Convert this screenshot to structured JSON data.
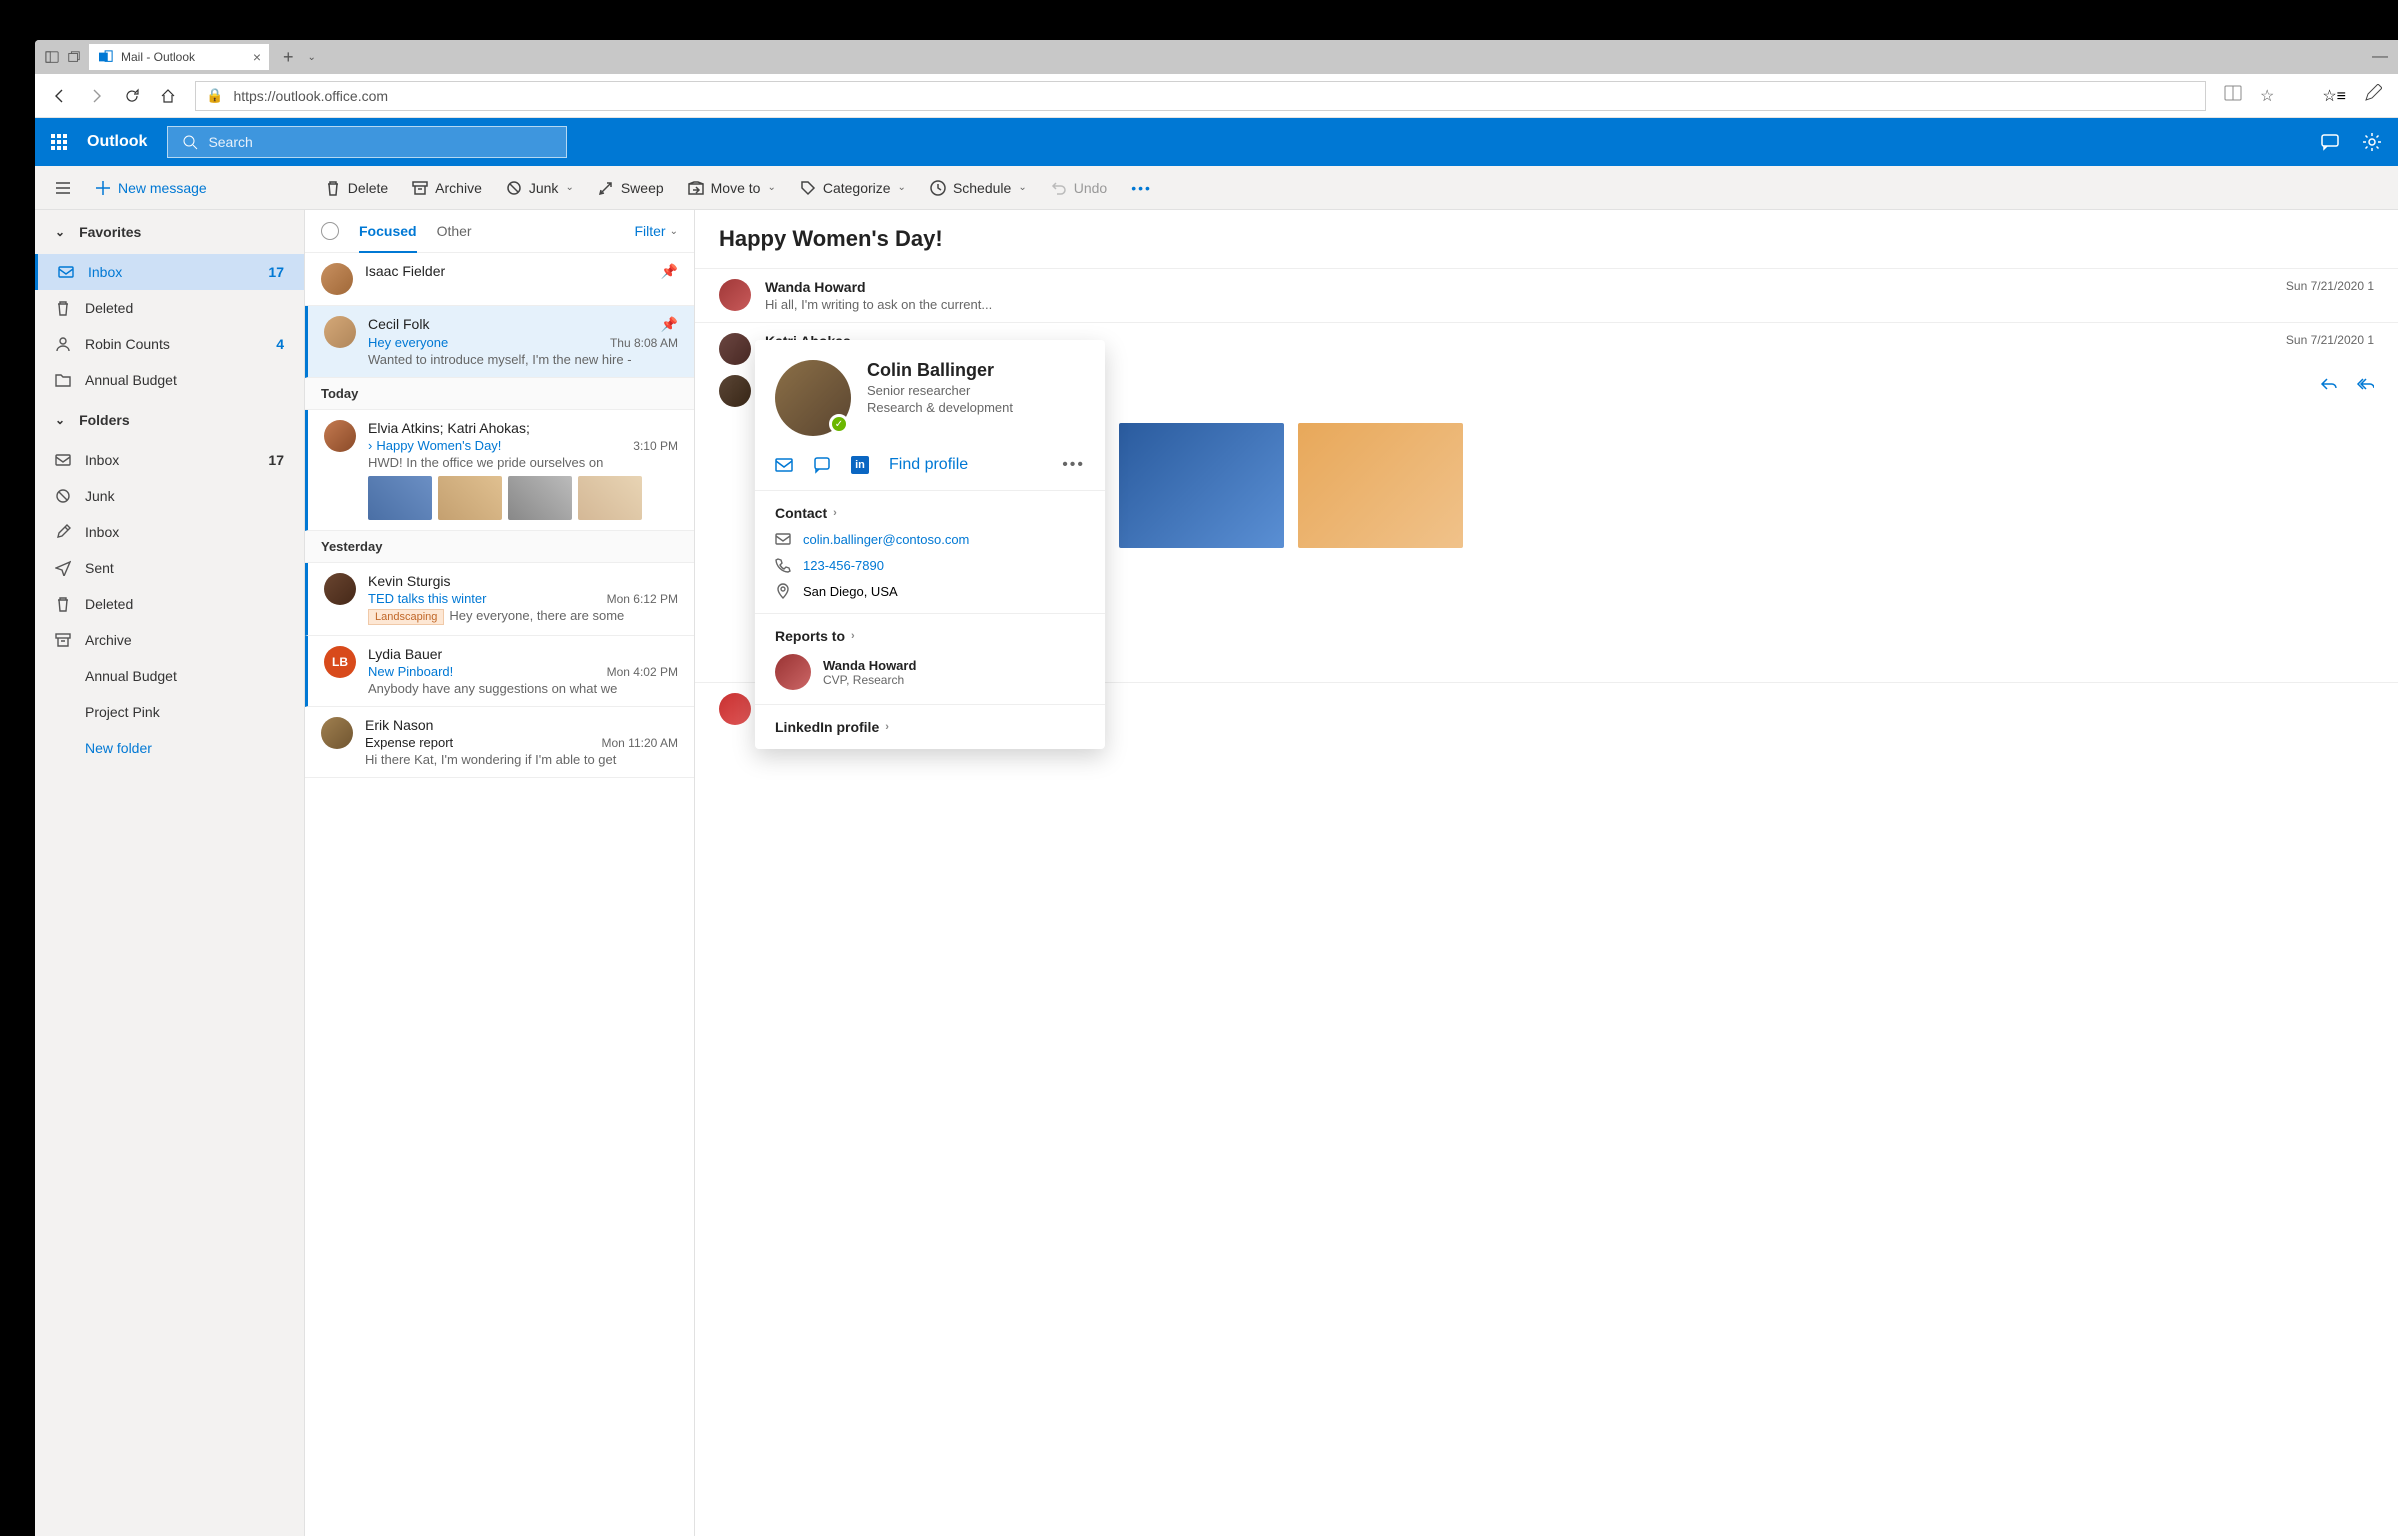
{
  "browser": {
    "tab_title": "Mail - Outlook",
    "url": "https://outlook.office.com"
  },
  "suite": {
    "app_name": "Outlook",
    "search_placeholder": "Search"
  },
  "commands": {
    "menu_label": "",
    "new_message": "New message",
    "delete": "Delete",
    "archive": "Archive",
    "junk": "Junk",
    "sweep": "Sweep",
    "move_to": "Move to",
    "categorize": "Categorize",
    "schedule": "Schedule",
    "undo": "Undo"
  },
  "sidebar": {
    "favorites_header": "Favorites",
    "folders_header": "Folders",
    "favorites": [
      {
        "label": "Inbox",
        "count": "17"
      },
      {
        "label": "Deleted",
        "count": ""
      },
      {
        "label": "Robin Counts",
        "count": "4"
      },
      {
        "label": "Annual Budget",
        "count": ""
      }
    ],
    "folders": [
      {
        "label": "Inbox",
        "count": "17"
      },
      {
        "label": "Junk",
        "count": ""
      },
      {
        "label": "Inbox",
        "count": ""
      },
      {
        "label": "Sent",
        "count": ""
      },
      {
        "label": "Deleted",
        "count": ""
      },
      {
        "label": "Archive",
        "count": ""
      },
      {
        "label": "Annual Budget",
        "count": ""
      },
      {
        "label": "Project Pink",
        "count": ""
      }
    ],
    "new_folder": "New folder"
  },
  "msglist": {
    "tab_focused": "Focused",
    "tab_other": "Other",
    "filter": "Filter",
    "sep_today": "Today",
    "sep_yesterday": "Yesterday",
    "items": [
      {
        "from": "Isaac Fielder",
        "subject": "",
        "time": "",
        "preview": "",
        "pinned": true
      },
      {
        "from": "Cecil Folk",
        "subject": "Hey everyone",
        "time": "Thu 8:08 AM",
        "preview": "Wanted to introduce myself, I'm the new hire -",
        "pinned": true,
        "selected": true
      },
      {
        "from": "Elvia Atkins; Katri Ahokas;",
        "subject": "Happy Women's Day!",
        "time": "3:10 PM",
        "preview": "HWD! In the office we pride ourselves on"
      },
      {
        "from": "Kevin Sturgis",
        "subject": "TED talks this winter",
        "time": "Mon 6:12 PM",
        "preview": "Hey everyone, there are some",
        "category": "Landscaping"
      },
      {
        "from": "Lydia Bauer",
        "subject": "New Pinboard!",
        "time": "Mon 4:02 PM",
        "preview": "Anybody have any suggestions on what we"
      },
      {
        "from": "Erik Nason",
        "subject": "Expense report",
        "time": "Mon 11:20 AM",
        "preview": "Hi there Kat, I'm wondering if I'm able to get"
      }
    ]
  },
  "reading": {
    "title": "Happy Women's Day!",
    "threads": [
      {
        "from": "Wanda Howard",
        "preview": "Hi all, I'm writing to ask on the current...",
        "date": "Sun 7/21/2020 1"
      },
      {
        "from": "Katri Ahokas",
        "preview": "",
        "date": "Sun 7/21/2020 1"
      }
    ]
  },
  "profile": {
    "name": "Colin Ballinger",
    "role": "Senior researcher",
    "dept": "Research & development",
    "find_profile": "Find profile",
    "contact_header": "Contact",
    "email": "colin.ballinger@contoso.com",
    "phone": "123-456-7890",
    "location": "San Diego, USA",
    "reports_to_header": "Reports to",
    "manager_name": "Wanda Howard",
    "manager_role": "CVP, Research",
    "linkedin_header": "LinkedIn profile"
  }
}
